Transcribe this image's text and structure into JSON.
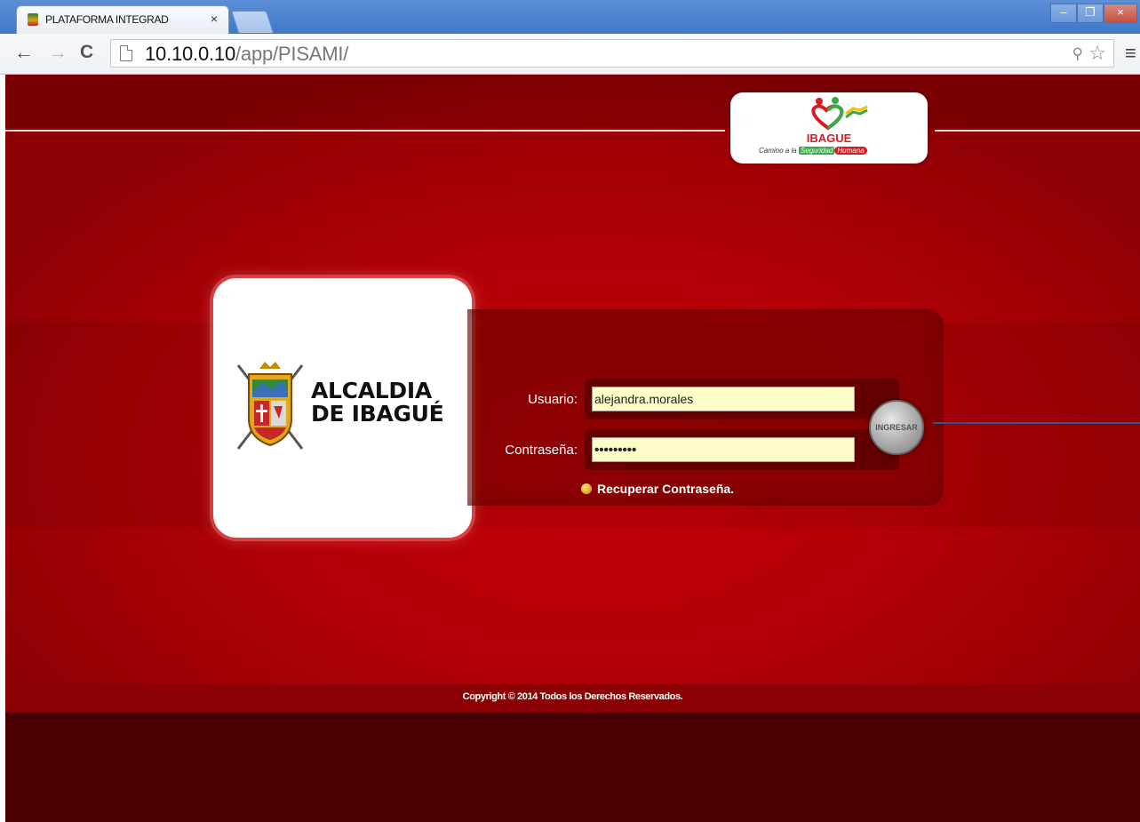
{
  "browser": {
    "tab_title": "PLATAFORMA INTEGRAD",
    "tab_close": "×",
    "url_host": "10.10.0.10",
    "url_path": "/app/PISAMI/",
    "back": "←",
    "forward": "→",
    "reload": "C",
    "menu": "≡",
    "zoom_icon": "⚲",
    "star_icon": "☆",
    "win_min": "–",
    "win_restore": "❐",
    "win_close": "×"
  },
  "brand": {
    "name": "IBAGUE",
    "slogan_prefix": "Camino a la",
    "slogan_green": "Seguridad",
    "slogan_red": "Humana"
  },
  "logo": {
    "line1": "ALCALDIA",
    "line2": "DE IBAGUÉ"
  },
  "login": {
    "user_label": "Usuario:",
    "user_value": "alejandra.morales",
    "password_label": "Contraseña:",
    "password_value": "•••••••••",
    "recover_label": "Recuperar Contraseña.",
    "submit_label": "INGRESAR"
  },
  "footer": {
    "copyright": "Copyright © 2014  Todos los Derechos Reservados."
  },
  "colors": {
    "background_red": "#b40006",
    "footer_dark": "#4a0003",
    "input_bg": "#fdfdc8"
  }
}
